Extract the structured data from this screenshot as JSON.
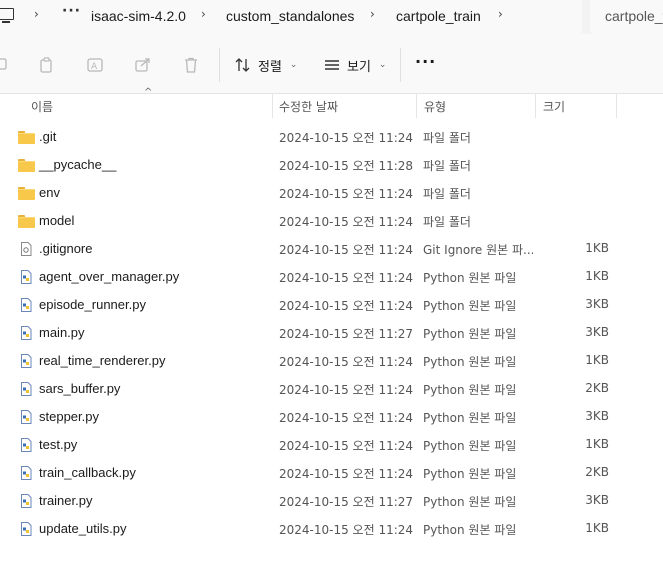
{
  "address": {
    "breadcrumbs": [
      "isaac-sim-4.2.0",
      "custom_standalones",
      "cartpole_train"
    ],
    "search_text": "cartpole_t"
  },
  "toolbar": {
    "sort_label": "정렬",
    "view_label": "보기",
    "more_label": "···"
  },
  "columns": {
    "name": "이름",
    "date": "수정한 날짜",
    "type": "유형",
    "size": "크기"
  },
  "files": [
    {
      "name": ".git",
      "date": "2024-10-15 오전 11:24",
      "type": "파일 폴더",
      "size": "",
      "kind": "folder"
    },
    {
      "name": "__pycache__",
      "date": "2024-10-15 오전 11:28",
      "type": "파일 폴더",
      "size": "",
      "kind": "folder"
    },
    {
      "name": "env",
      "date": "2024-10-15 오전 11:24",
      "type": "파일 폴더",
      "size": "",
      "kind": "folder"
    },
    {
      "name": "model",
      "date": "2024-10-15 오전 11:24",
      "type": "파일 폴더",
      "size": "",
      "kind": "folder"
    },
    {
      "name": ".gitignore",
      "date": "2024-10-15 오전 11:24",
      "type": "Git Ignore 원본 파...",
      "size": "1KB",
      "kind": "gitignore"
    },
    {
      "name": "agent_over_manager.py",
      "date": "2024-10-15 오전 11:24",
      "type": "Python 원본 파일",
      "size": "1KB",
      "kind": "python"
    },
    {
      "name": "episode_runner.py",
      "date": "2024-10-15 오전 11:24",
      "type": "Python 원본 파일",
      "size": "3KB",
      "kind": "python"
    },
    {
      "name": "main.py",
      "date": "2024-10-15 오전 11:27",
      "type": "Python 원본 파일",
      "size": "3KB",
      "kind": "python"
    },
    {
      "name": "real_time_renderer.py",
      "date": "2024-10-15 오전 11:24",
      "type": "Python 원본 파일",
      "size": "1KB",
      "kind": "python"
    },
    {
      "name": "sars_buffer.py",
      "date": "2024-10-15 오전 11:24",
      "type": "Python 원본 파일",
      "size": "2KB",
      "kind": "python"
    },
    {
      "name": "stepper.py",
      "date": "2024-10-15 오전 11:24",
      "type": "Python 원본 파일",
      "size": "3KB",
      "kind": "python"
    },
    {
      "name": "test.py",
      "date": "2024-10-15 오전 11:24",
      "type": "Python 원본 파일",
      "size": "1KB",
      "kind": "python"
    },
    {
      "name": "train_callback.py",
      "date": "2024-10-15 오전 11:24",
      "type": "Python 원본 파일",
      "size": "2KB",
      "kind": "python"
    },
    {
      "name": "trainer.py",
      "date": "2024-10-15 오전 11:27",
      "type": "Python 원본 파일",
      "size": "3KB",
      "kind": "python"
    },
    {
      "name": "update_utils.py",
      "date": "2024-10-15 오전 11:24",
      "type": "Python 원본 파일",
      "size": "1KB",
      "kind": "python"
    }
  ]
}
